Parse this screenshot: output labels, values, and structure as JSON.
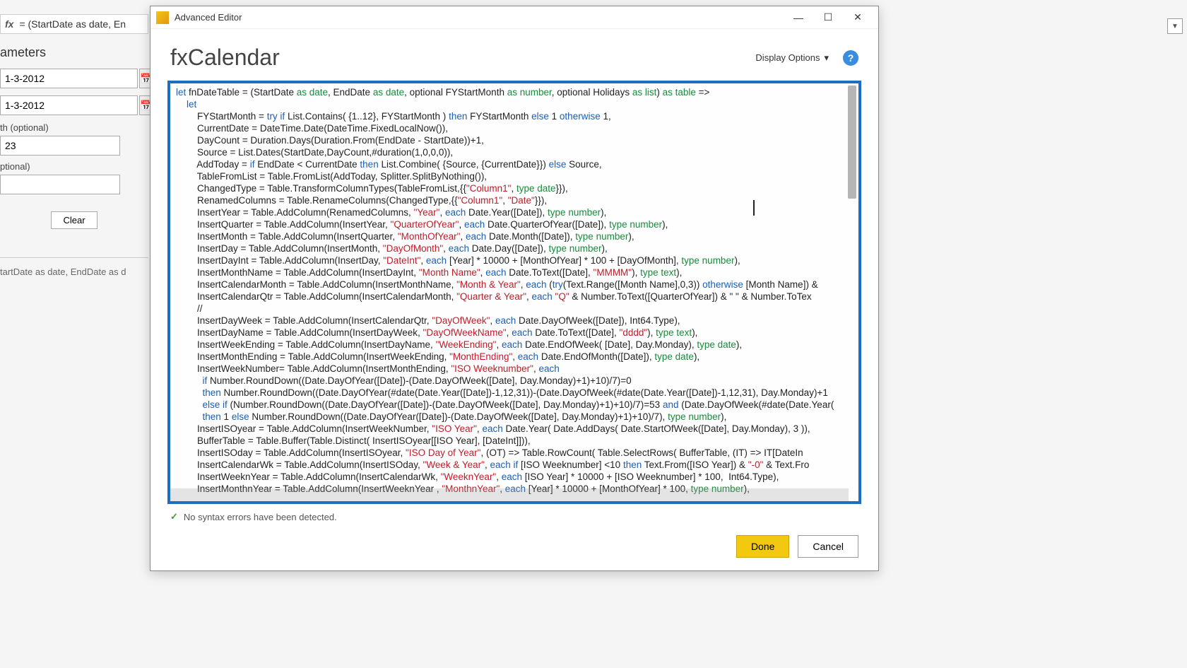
{
  "background": {
    "formula_prefix_fx": "fx",
    "formula_text_visible": "= (StartDate as date, En",
    "sidebar": {
      "heading": "ameters",
      "date1": "1-3-2012",
      "date2": "1-3-2012",
      "label_optional_1": "th (optional)",
      "field_small": "23",
      "label_optional_2": "ptional)",
      "clear_label": "Clear",
      "signature": "tartDate as date, EndDate as d"
    }
  },
  "dropdown_glyph": "▼",
  "dialog": {
    "window_title": "Advanced Editor",
    "minimize": "—",
    "maximize": "☐",
    "close": "✕",
    "heading": "fxCalendar",
    "display_options": "Display Options",
    "display_caret": "▾",
    "help": "?",
    "status_tick": "✓",
    "status_text": "No syntax errors have been detected.",
    "done": "Done",
    "cancel": "Cancel"
  },
  "code_lines": [
    {
      "t": "let fnDateTable = (StartDate ",
      "a": "as date",
      "b": ", EndDate ",
      "c": "as date",
      "d": ", optional FYStartMonth ",
      "e": "as number",
      "f": ", optional Holidays ",
      "g": "as list",
      "h": ") ",
      "i": "as table",
      "j": " =>"
    },
    {
      "lead": "    ",
      "t": "let"
    },
    {
      "lead": "        ",
      "t": "FYStartMonth = ",
      "blue": "try if",
      "t2": " List.Contains( {1..12}, FYStartMonth ) ",
      "blue2": "then",
      "t3": " FYStartMonth ",
      "blue3": "else",
      "t4": " 1 ",
      "blue4": "otherwise",
      "t5": " 1,"
    },
    {
      "lead": "        ",
      "t": "CurrentDate = DateTime.Date(DateTime.FixedLocalNow()),"
    },
    {
      "lead": "        ",
      "t": "DayCount = Duration.Days(Duration.From(EndDate - StartDate))+1,"
    },
    {
      "lead": "        ",
      "t": "Source = List.Dates(StartDate,DayCount,#duration(1,0,0,0)),"
    },
    {
      "lead": "        ",
      "t": "AddToday = ",
      "blue": "if",
      "t2": " EndDate < CurrentDate ",
      "blue2": "then",
      "t3": " List.Combine( {Source, {CurrentDate}}) ",
      "blue3": "else",
      "t4": " Source,"
    },
    {
      "lead": "        ",
      "t": "TableFromList = Table.FromList(AddToday, Splitter.SplitByNothing()),"
    },
    {
      "lead": "        ",
      "t": "ChangedType = Table.TransformColumnTypes(TableFromList,{{",
      "red": "\"Column1\"",
      "t2": ", ",
      "green": "type date",
      "t3": "}}),"
    },
    {
      "lead": "        ",
      "t": "RenamedColumns = Table.RenameColumns(ChangedType,{{",
      "red": "\"Column1\"",
      "t2": ", ",
      "red2": "\"Date\"",
      "t3": "}}),"
    },
    {
      "lead": "        ",
      "t": "InsertYear = Table.AddColumn(RenamedColumns, ",
      "red": "\"Year\"",
      "t2": ", ",
      "blue": "each",
      "t3": " Date.Year([Date]), ",
      "green": "type number",
      "t4": "),"
    },
    {
      "lead": "        ",
      "t": "InsertQuarter = Table.AddColumn(InsertYear, ",
      "red": "\"QuarterOfYear\"",
      "t2": ", ",
      "blue": "each",
      "t3": " Date.QuarterOfYear([Date]), ",
      "green": "type number",
      "t4": "),"
    },
    {
      "lead": "        ",
      "t": "InsertMonth = Table.AddColumn(InsertQuarter, ",
      "red": "\"MonthOfYear\"",
      "t2": ", ",
      "blue": "each",
      "t3": " Date.Month([Date]), ",
      "green": "type number",
      "t4": "),"
    },
    {
      "lead": "        ",
      "t": "InsertDay = Table.AddColumn(InsertMonth, ",
      "red": "\"DayOfMonth\"",
      "t2": ", ",
      "blue": "each",
      "t3": " Date.Day([Date]), ",
      "green": "type number",
      "t4": "),"
    },
    {
      "lead": "        ",
      "t": "InsertDayInt = Table.AddColumn(InsertDay, ",
      "red": "\"DateInt\"",
      "t2": ", ",
      "blue": "each",
      "t3": " [Year] * 10000 + [MonthOfYear] * 100 + [DayOfMonth], ",
      "green": "type number",
      "t4": "),"
    },
    {
      "lead": "        ",
      "t": "InsertMonthName = Table.AddColumn(InsertDayInt, ",
      "red": "\"Month Name\"",
      "t2": ", ",
      "blue": "each",
      "t3": " Date.ToText([Date], ",
      "red2": "\"MMMM\"",
      "t4": "), ",
      "green": "type text",
      "t5": "),"
    },
    {
      "lead": "        ",
      "t": "InsertCalendarMonth = Table.AddColumn(InsertMonthName, ",
      "red": "\"Month & Year\"",
      "t2": ", ",
      "blue": "each",
      "t3": " (",
      "blue2": "try",
      "t4": "(Text.Range([Month Name],0,3)) ",
      "blue3": "otherwise",
      "t5": " [Month Name]) & "
    },
    {
      "lead": "        ",
      "t": "InsertCalendarQtr = Table.AddColumn(InsertCalendarMonth, ",
      "red": "\"Quarter & Year\"",
      "t2": ", ",
      "blue": "each",
      "t3": " ",
      "red2": "\"Q\"",
      "t4": " & Number.ToText([QuarterOfYear]) & \" \" & Number.ToTex"
    },
    {
      "lead": "        ",
      "t": "//"
    },
    {
      "lead": "        ",
      "t": "InsertDayWeek = Table.AddColumn(InsertCalendarQtr, ",
      "red": "\"DayOfWeek\"",
      "t2": ", ",
      "blue": "each",
      "t3": " Date.DayOfWeek([Date]), Int64.Type),"
    },
    {
      "lead": "        ",
      "t": "InsertDayName = Table.AddColumn(InsertDayWeek, ",
      "red": "\"DayOfWeekName\"",
      "t2": ", ",
      "blue": "each",
      "t3": " Date.ToText([Date], ",
      "red2": "\"dddd\"",
      "t4": "), ",
      "green": "type text",
      "t5": "),"
    },
    {
      "lead": "        ",
      "t": "InsertWeekEnding = Table.AddColumn(InsertDayName, ",
      "red": "\"WeekEnding\"",
      "t2": ", ",
      "blue": "each",
      "t3": " Date.EndOfWeek( [Date], Day.Monday), ",
      "green": "type date",
      "t4": "),"
    },
    {
      "lead": "        ",
      "t": "InsertMonthEnding = Table.AddColumn(InsertWeekEnding, ",
      "red": "\"MonthEnding\"",
      "t2": ", ",
      "blue": "each",
      "t3": " Date.EndOfMonth([Date]), ",
      "green": "type date",
      "t4": "),"
    },
    {
      "lead": "        ",
      "t": "InsertWeekNumber= Table.AddColumn(InsertMonthEnding, ",
      "red": "\"ISO Weeknumber\"",
      "t2": ", ",
      "blue": "each"
    },
    {
      "lead": "          ",
      "blue": "if",
      "t": " Number.RoundDown((Date.DayOfYear([Date])-(Date.DayOfWeek([Date], Day.Monday)+1)+10)/7)=0"
    },
    {
      "lead": "          ",
      "blue": "then",
      "t": " Number.RoundDown((Date.DayOfYear(#date(Date.Year([Date])-1,12,31))-(Date.DayOfWeek(#date(Date.Year([Date])-1,12,31), Day.Monday)+1"
    },
    {
      "lead": "          ",
      "blue": "else if",
      "t": " (Number.RoundDown((Date.DayOfYear([Date])-(Date.DayOfWeek([Date], Day.Monday)+1)+10)/7)=53 ",
      "blue2": "and",
      "t2": " (Date.DayOfWeek(#date(Date.Year("
    },
    {
      "lead": "          ",
      "blue": "then",
      "t": " 1 ",
      "blue2": "else",
      "t2": " Number.RoundDown((Date.DayOfYear([Date])-(Date.DayOfWeek([Date], Day.Monday)+1)+10)/7), ",
      "green": "type number",
      "t3": "),"
    },
    {
      "lead": "        ",
      "t": "InsertISOyear = Table.AddColumn(InsertWeekNumber, ",
      "red": "\"ISO Year\"",
      "t2": ", ",
      "blue": "each",
      "t3": " Date.Year( Date.AddDays( Date.StartOfWeek([Date], Day.Monday), 3 )),"
    },
    {
      "lead": "        ",
      "t": "BufferTable = Table.Buffer(Table.Distinct( InsertISOyear[[ISO Year], [DateInt]])),"
    },
    {
      "lead": "        ",
      "t": "InsertISOday = Table.AddColumn(InsertISOyear, ",
      "red": "\"ISO Day of Year\"",
      "t2": ", (OT) => Table.RowCount( Table.SelectRows( BufferTable, (IT) => IT[DateIn"
    },
    {
      "lead": "        ",
      "t": "InsertCalendarWk = Table.AddColumn(InsertISOday, ",
      "red": "\"Week & Year\"",
      "t2": ", ",
      "blue": "each if",
      "t3": " [ISO Weeknumber] <10 ",
      "blue2": "then",
      "t4": " Text.From([ISO Year]) & ",
      "red2": "\"-0\"",
      "t5": " & Text.Fro"
    },
    {
      "lead": "        ",
      "t": "InsertWeeknYear = Table.AddColumn(InsertCalendarWk, ",
      "red": "\"WeeknYear\"",
      "t2": ", ",
      "blue": "each",
      "t3": " [ISO Year] * 10000 + [ISO Weeknumber] * 100,  Int64.Type),"
    },
    {
      "lead": "",
      "t": ""
    },
    {
      "lead": "        ",
      "t": "InsertMonthnYear = Table.AddColumn(InsertWeeknYear , ",
      "red": "\"MonthnYear\"",
      "t2": ", ",
      "blue": "each",
      "t3": " [Year] * 10000 + [MonthOfYear] * 100, ",
      "green": "type number",
      "t4": "),"
    }
  ]
}
